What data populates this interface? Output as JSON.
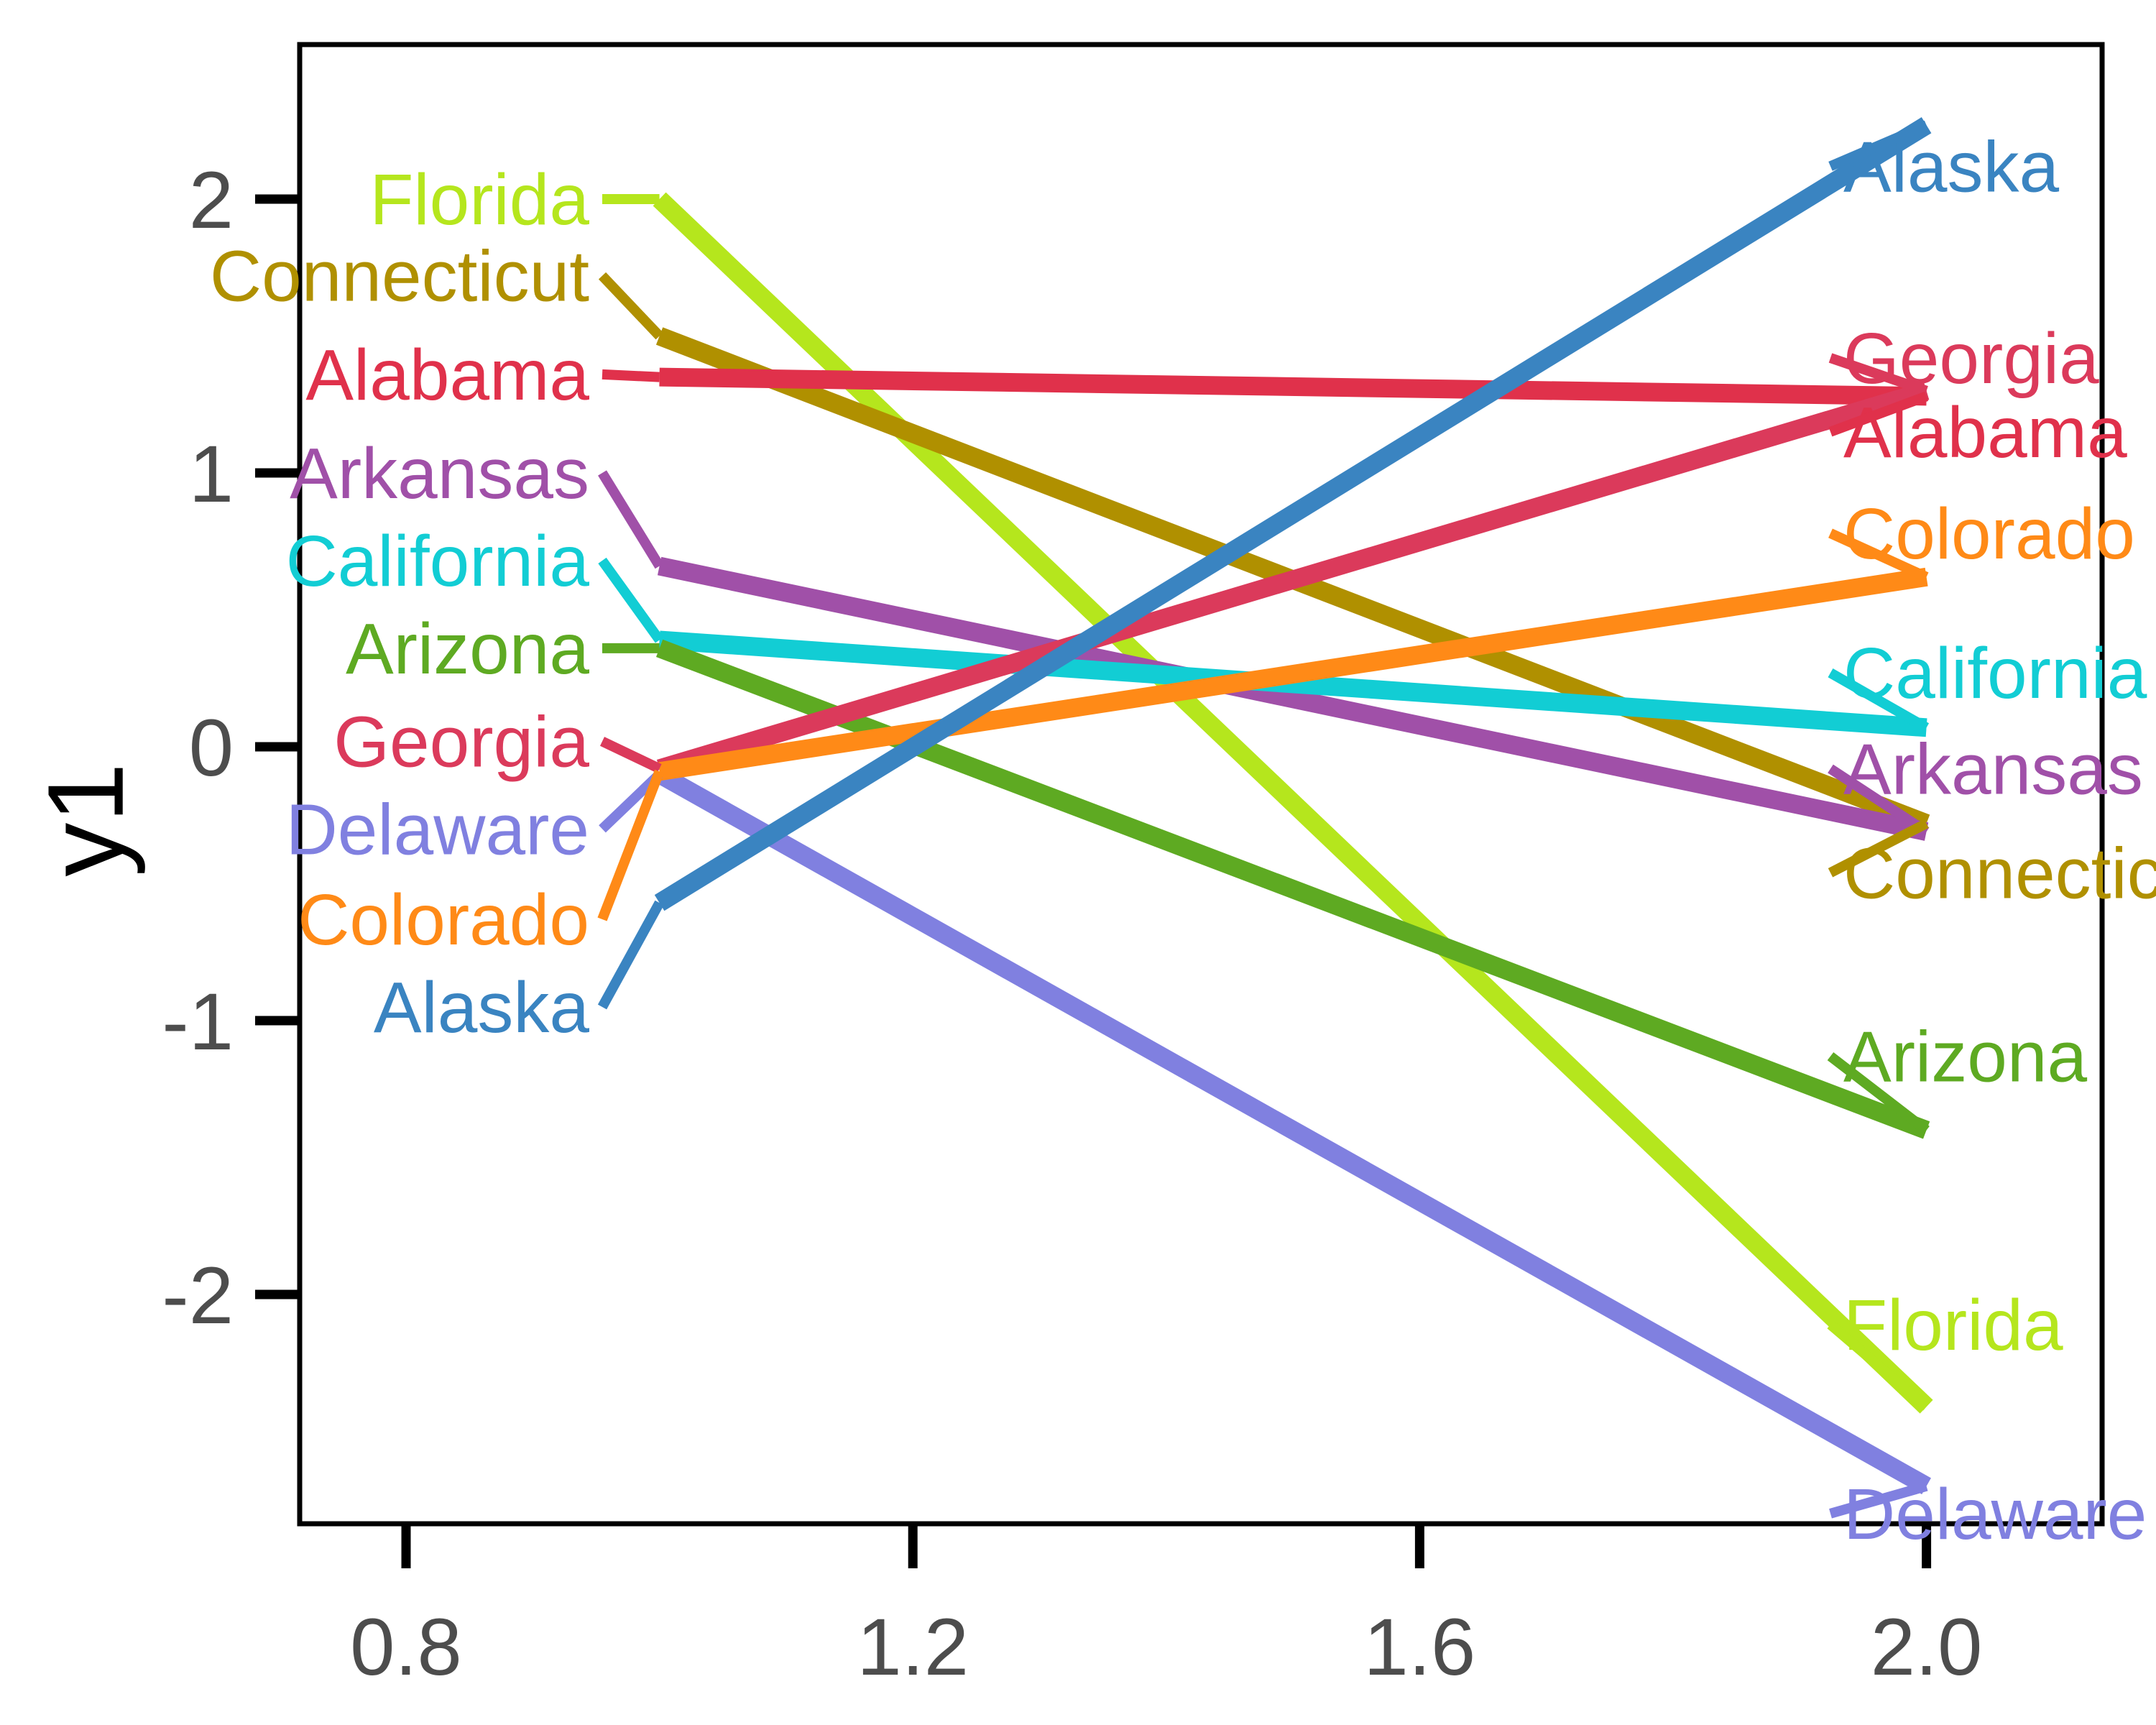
{
  "chart_data": {
    "type": "line",
    "title": "",
    "subtitle": "",
    "xlabel": "",
    "ylabel": "y1",
    "x": [
      1.0,
      2.0
    ],
    "xlim": [
      0.73,
      2.09
    ],
    "ylim": [
      -2.95,
      2.47
    ],
    "xticks": [
      "0.8",
      "1.2",
      "1.6",
      "2.0"
    ],
    "xtick_values": [
      0.8,
      1.2,
      1.6,
      2.0
    ],
    "yticks": [
      "2",
      "1",
      "0",
      "-1",
      "-2"
    ],
    "ytick_values": [
      2,
      1,
      0,
      -1,
      -2
    ],
    "grid": false,
    "legend": "direct-labels-both-sides",
    "series": [
      {
        "name": "Florida",
        "color": "#b5e61d",
        "values": [
          2.0,
          -2.41
        ]
      },
      {
        "name": "Connecticut",
        "color": "#b09000",
        "values": [
          1.5,
          -0.28
        ]
      },
      {
        "name": "Alabama",
        "color": "#e0314b",
        "values": [
          1.35,
          1.28
        ]
      },
      {
        "name": "Arkansas",
        "color": "#a050a8",
        "values": [
          0.66,
          -0.31
        ]
      },
      {
        "name": "California",
        "color": "#12cdd4",
        "values": [
          0.39,
          0.07
        ]
      },
      {
        "name": "Arizona",
        "color": "#5eaa22",
        "values": [
          0.36,
          -1.4
        ]
      },
      {
        "name": "Georgia",
        "color": "#db3a5b",
        "values": [
          -0.08,
          1.3
        ]
      },
      {
        "name": "Delaware",
        "color": "#8080e0",
        "values": [
          -0.1,
          -2.7
        ]
      },
      {
        "name": "Colorado",
        "color": "#ff8a17",
        "values": [
          -0.09,
          0.62
        ]
      },
      {
        "name": "Alaska",
        "color": "#3a84c1",
        "values": [
          -0.57,
          2.27
        ]
      }
    ],
    "left_labels": [
      {
        "name": "Florida",
        "color": "#b5e61d",
        "y": 2.0
      },
      {
        "name": "Connecticut",
        "color": "#b09000",
        "y": 1.72
      },
      {
        "name": "Alabama",
        "color": "#e0314b",
        "y": 1.36
      },
      {
        "name": "Arkansas",
        "color": "#a050a8",
        "y": 1.0
      },
      {
        "name": "California",
        "color": "#12cdd4",
        "y": 0.68
      },
      {
        "name": "Arizona",
        "color": "#5eaa22",
        "y": 0.36
      },
      {
        "name": "Georgia",
        "color": "#db3a5b",
        "y": 0.02
      },
      {
        "name": "Delaware",
        "color": "#8080e0",
        "y": -0.3
      },
      {
        "name": "Colorado",
        "color": "#ff8a17",
        "y": -0.63
      },
      {
        "name": "Alaska",
        "color": "#3a84c1",
        "y": -0.95
      }
    ],
    "right_labels": [
      {
        "name": "Alaska",
        "color": "#3a84c1",
        "y": 2.12
      },
      {
        "name": "Georgia",
        "color": "#db3a5b",
        "y": 1.42
      },
      {
        "name": "Alabama",
        "color": "#e0314b",
        "y": 1.15
      },
      {
        "name": "Colorado",
        "color": "#ff8a17",
        "y": 0.78
      },
      {
        "name": "California",
        "color": "#12cdd4",
        "y": 0.27
      },
      {
        "name": "Arkansas",
        "color": "#a050a8",
        "y": -0.08
      },
      {
        "name": "Connecticut",
        "color": "#b09000",
        "y": -0.46
      },
      {
        "name": "Arizona",
        "color": "#5eaa22",
        "y": -1.13
      },
      {
        "name": "Florida",
        "color": "#b5e61d",
        "y": -2.11
      },
      {
        "name": "Delaware",
        "color": "#8080e0",
        "y": -2.8
      }
    ]
  },
  "axis": {
    "y_title": "y1"
  }
}
